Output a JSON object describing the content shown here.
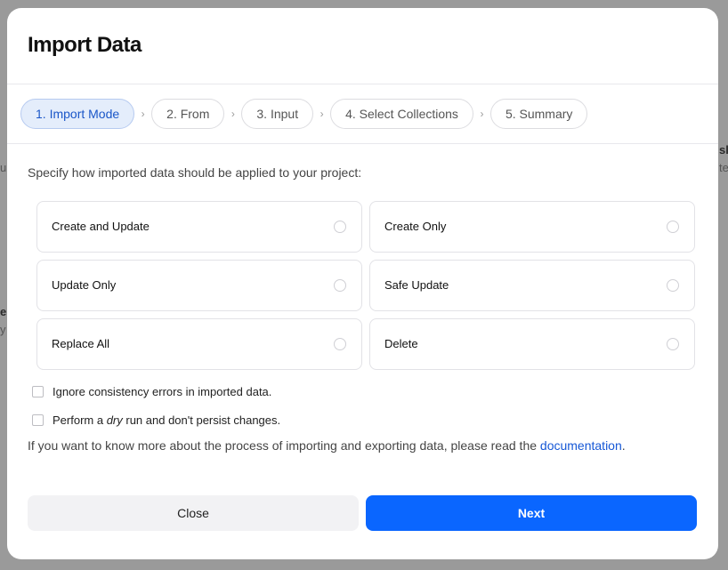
{
  "background": {
    "peek_right_top": "sl",
    "peek_right_top2": "te",
    "peek_left_top": "ur",
    "peek_left_mid": "e",
    "peek_left_mid2": "y"
  },
  "modal": {
    "title": "Import Data",
    "steps": [
      {
        "label": "1. Import Mode",
        "active": true
      },
      {
        "label": "2. From",
        "active": false
      },
      {
        "label": "3. Input",
        "active": false
      },
      {
        "label": "4. Select Collections",
        "active": false
      },
      {
        "label": "5. Summary",
        "active": false
      }
    ],
    "step_separator": "›",
    "prompt": "Specify how imported data should be applied to your project:",
    "options": [
      {
        "label": "Create and Update",
        "selected": false
      },
      {
        "label": "Create Only",
        "selected": false
      },
      {
        "label": "Update Only",
        "selected": false
      },
      {
        "label": "Safe Update",
        "selected": false
      },
      {
        "label": "Replace All",
        "selected": false
      },
      {
        "label": "Delete",
        "selected": false
      }
    ],
    "checkboxes": {
      "ignore_errors": {
        "label": "Ignore consistency errors in imported data.",
        "checked": false
      },
      "dry_run": {
        "label_before": "Perform a ",
        "label_em": "dry",
        "label_after": " run and don't persist changes.",
        "checked": false
      }
    },
    "info": {
      "text": "If you want to know more about the process of importing and exporting data, please read the ",
      "link": "documentation",
      "end": "."
    },
    "buttons": {
      "close": "Close",
      "next": "Next"
    },
    "colors": {
      "accent": "#0a66ff",
      "active_step_bg": "#e4edfb",
      "link": "#1557d6"
    }
  }
}
